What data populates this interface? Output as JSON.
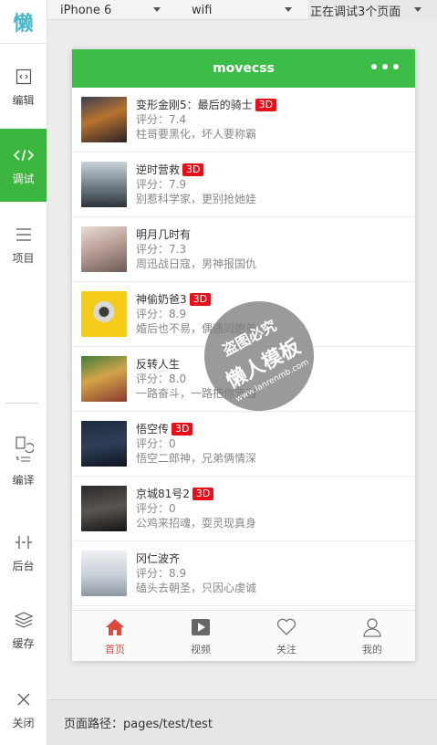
{
  "sidebar": {
    "logo": "懒",
    "items": [
      {
        "label": "编辑",
        "icon": "code-file-icon"
      },
      {
        "label": "调试",
        "icon": "code-icon"
      },
      {
        "label": "项目",
        "icon": "menu-icon"
      },
      {
        "label": "编译",
        "icon": "compile-icon"
      },
      {
        "label": "后台",
        "icon": "backend-icon"
      },
      {
        "label": "缓存",
        "icon": "layers-icon"
      },
      {
        "label": "关闭",
        "icon": "close-icon"
      }
    ]
  },
  "topbar": {
    "device": "iPhone 6",
    "network": "wifi",
    "status": "正在调试3个页面"
  },
  "phone": {
    "nav_title": "movecss",
    "movies": [
      {
        "title": "变形金刚5：最后的骑士",
        "badge": "3D",
        "rating": "评分：7.4",
        "desc": "柱哥要黑化，坏人要称霸"
      },
      {
        "title": "逆时营救",
        "badge": "3D",
        "rating": "评分：7.9",
        "desc": "别惹科学家，更别抢她娃"
      },
      {
        "title": "明月几时有",
        "badge": "",
        "rating": "评分：7.3",
        "desc": "周迅战日寇，男神报国仇"
      },
      {
        "title": "神偷奶爸3",
        "badge": "3D",
        "rating": "评分：8.9",
        "desc": "婚后也不易，偶遇同胞弟"
      },
      {
        "title": "反转人生",
        "badge": "",
        "rating": "评分：8.0",
        "desc": "一路奋斗，一路把你宠遍"
      },
      {
        "title": "悟空传",
        "badge": "3D",
        "rating": "评分：0",
        "desc": "悟空二郎神，兄弟俩情深"
      },
      {
        "title": "京城81号2",
        "badge": "3D",
        "rating": "评分：0",
        "desc": "公鸡来招魂，耍灵现真身"
      },
      {
        "title": "冈仁波齐",
        "badge": "",
        "rating": "评分：8.9",
        "desc": "磕头去朝圣，只因心虔诚"
      }
    ],
    "tabs": [
      {
        "label": "首页",
        "icon": "home-icon"
      },
      {
        "label": "视频",
        "icon": "video-icon"
      },
      {
        "label": "关注",
        "icon": "heart-icon"
      },
      {
        "label": "我的",
        "icon": "user-icon"
      }
    ]
  },
  "pathbar": {
    "text": "页面路径：pages/test/test"
  },
  "watermark": {
    "line1": "盗图必究",
    "line2": "懒人模板",
    "line3": "www.lanrenmb.com"
  },
  "colors": {
    "accent_green": "#3cbd47",
    "sidebar_active": "#3cb63e",
    "badge_red": "#e7101a",
    "tab_active": "#e0483a"
  }
}
